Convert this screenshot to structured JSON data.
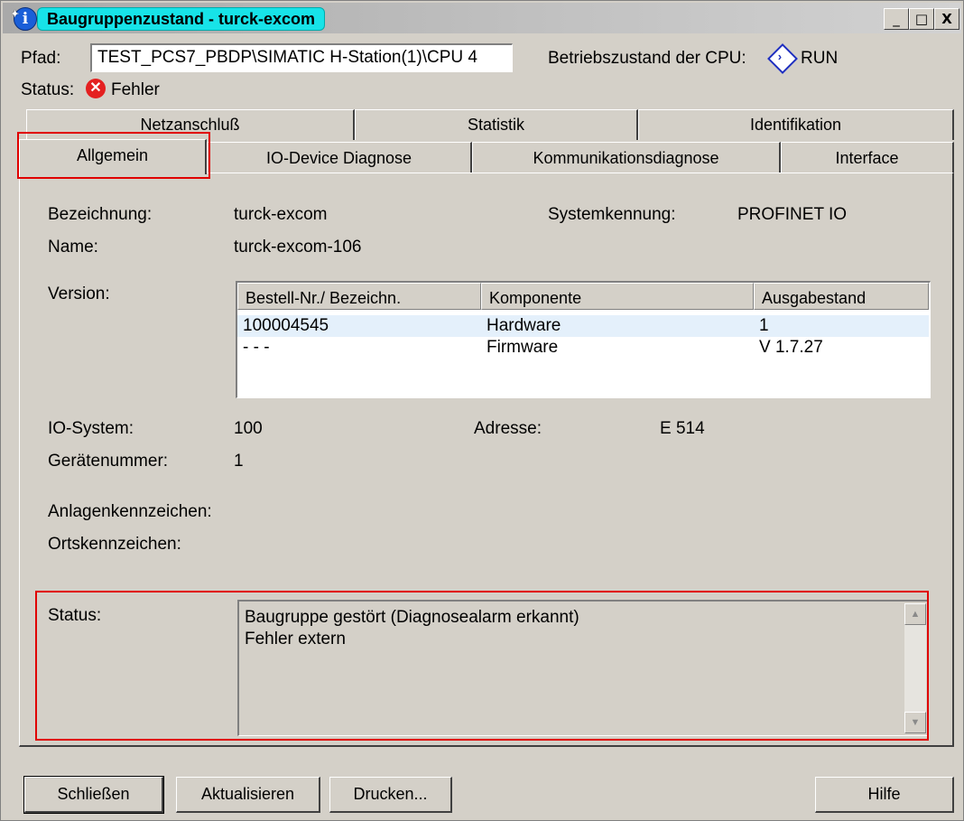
{
  "window": {
    "title": "Baugruppenzustand - turck-excom",
    "minimize": "_",
    "maximize": "□",
    "close": "X"
  },
  "header": {
    "path_label": "Pfad:",
    "path_value": "TEST_PCS7_PBDP\\SIMATIC H-Station(1)\\CPU 4",
    "cpu_state_label": "Betriebszustand der CPU:",
    "cpu_state_value": "RUN",
    "status_label": "Status:",
    "status_value": "Fehler"
  },
  "tabs": {
    "row_back": [
      "Netzanschluß",
      "Statistik",
      "Identifikation"
    ],
    "row_front": [
      "Allgemein",
      "IO-Device Diagnose",
      "Kommunikationsdiagnose",
      "Interface"
    ],
    "active": "Allgemein"
  },
  "general": {
    "bezeichnung_label": "Bezeichnung:",
    "bezeichnung_value": "turck-excom",
    "systemkennung_label": "Systemkennung:",
    "systemkennung_value": "PROFINET IO",
    "name_label": "Name:",
    "name_value": "turck-excom-106",
    "version_label": "Version:",
    "version_table": {
      "columns": [
        "Bestell-Nr./ Bezeichn.",
        "Komponente",
        "Ausgabestand"
      ],
      "rows": [
        [
          "100004545",
          "Hardware",
          "1"
        ],
        [
          "- - -",
          "Firmware",
          "V 1.7.27"
        ]
      ]
    },
    "io_system_label": "IO-System:",
    "io_system_value": "100",
    "adresse_label": "Adresse:",
    "adresse_value": "E 514",
    "geraetenummer_label": "Gerätenummer:",
    "geraetenummer_value": "1",
    "anlagenkennzeichen_label": "Anlagenkennzeichen:",
    "ortskennzeichen_label": "Ortskennzeichen:",
    "status_label": "Status:",
    "status_lines": [
      "Baugruppe gestört (Diagnosealarm erkannt)",
      "Fehler extern"
    ]
  },
  "buttons": {
    "close": "Schließen",
    "refresh": "Aktualisieren",
    "print": "Drucken...",
    "help": "Hilfe"
  },
  "colors": {
    "dialog_bg": "#d4d0c8",
    "title_highlight": "#17e3e8",
    "annotation_red": "#e00000",
    "selected_row": "#e4f0fb"
  }
}
